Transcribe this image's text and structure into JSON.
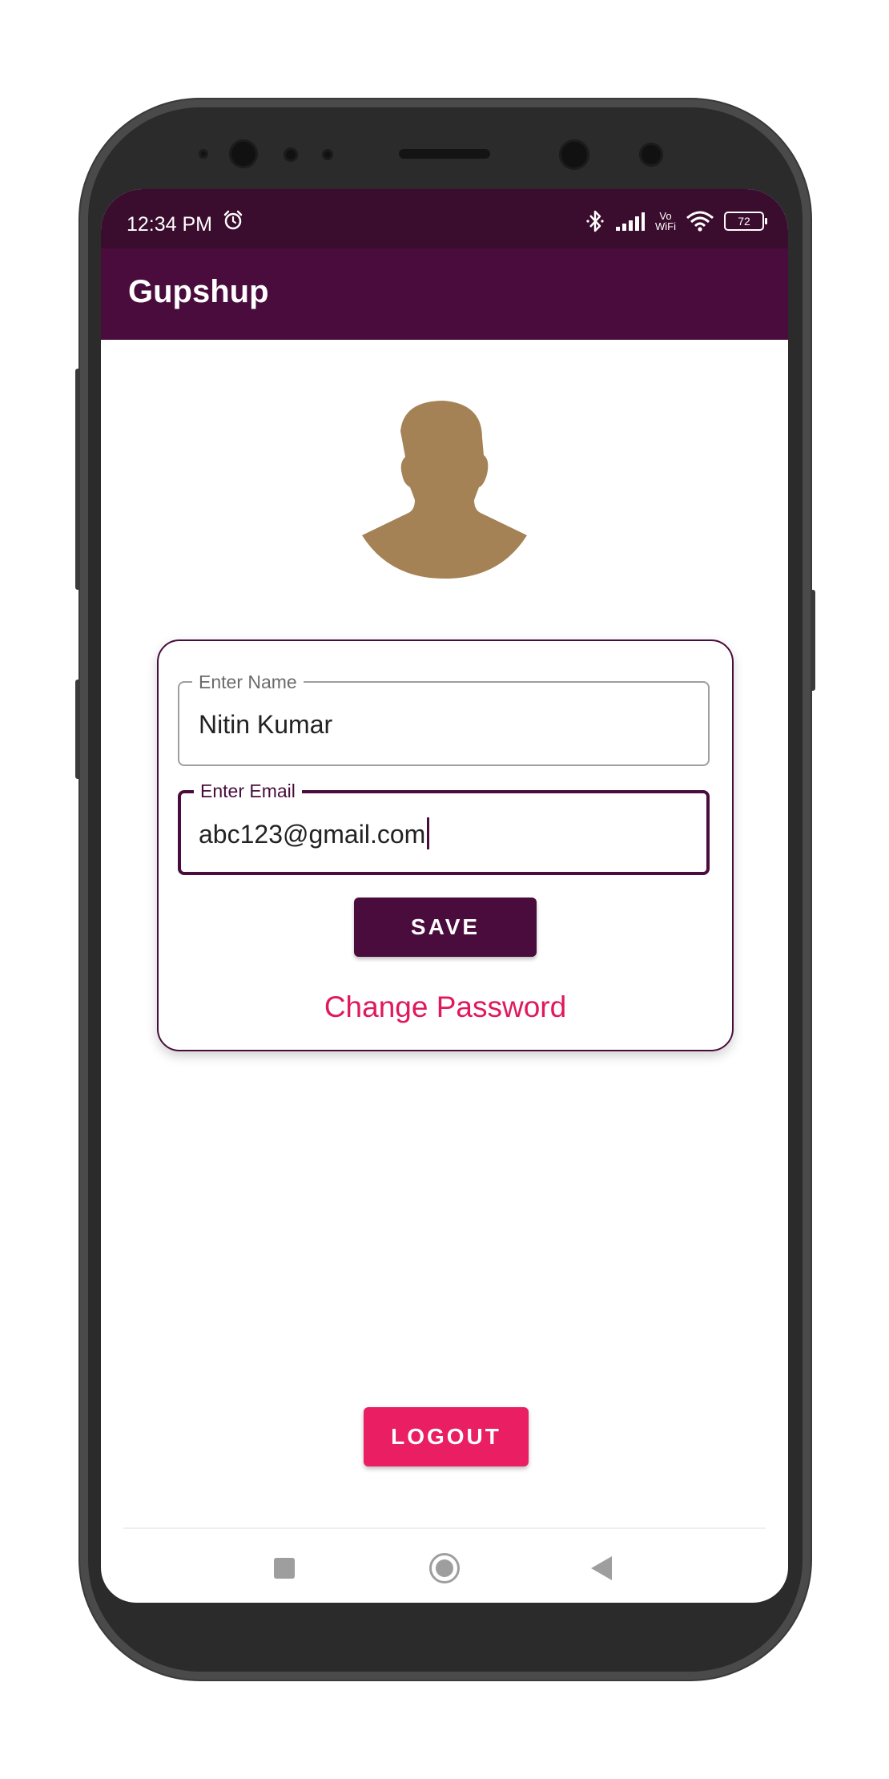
{
  "status_bar": {
    "time": "12:34 PM",
    "icons": [
      "alarm-icon",
      "bluetooth-icon",
      "signal-icon",
      "vowifi-icon",
      "wifi-icon",
      "battery-icon"
    ],
    "vowifi_top": "Vo",
    "vowifi_bottom": "WiFi",
    "battery_level": "72"
  },
  "app_bar": {
    "title": "Gupshup"
  },
  "profile": {
    "avatar_icon": "person-silhouette-icon",
    "name_field": {
      "label": "Enter Name",
      "value": "Nitin Kumar"
    },
    "email_field": {
      "label": "Enter Email",
      "value": "abc123@gmail.com"
    },
    "save_label": "SAVE",
    "change_password_label": "Change Password"
  },
  "logout_label": "LOGOUT",
  "nav_bar": {
    "icons": [
      "recent-apps-icon",
      "home-icon",
      "back-icon"
    ]
  },
  "colors": {
    "status_bar": "#3a0c2d",
    "app_bar": "#490c3c",
    "accent_pink": "#e91e63",
    "avatar": "#a48255"
  }
}
